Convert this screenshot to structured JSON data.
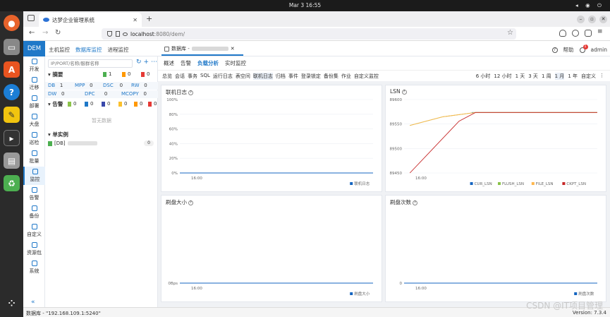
{
  "os": {
    "clock": "Mar 3  16:55"
  },
  "browser": {
    "tab_title": "达梦企业管理系统",
    "url_host": "localhost",
    "url_path": ":8080/dem/"
  },
  "app": {
    "brand": "DEM",
    "top_nav": [
      "主机监控",
      "数据库监控",
      "进程监控"
    ],
    "page_tab": "数据库 - ",
    "help": "帮助",
    "user": "admin",
    "badge": "1"
  },
  "side_nav": [
    "开发",
    "迁移",
    "部署",
    "大盘",
    "巡检",
    "批量",
    "监控",
    "告警",
    "备份",
    "自定义",
    "资源包",
    "系统"
  ],
  "instance_panel": {
    "search_placeholder": "IP/PORT/名称/服群名称",
    "summary_title": "摘要",
    "summary_counts": [
      "1",
      "0",
      "0"
    ],
    "db_types": [
      {
        "k": "DB",
        "v": "1"
      },
      {
        "k": "MPP",
        "v": "0"
      },
      {
        "k": "DSC",
        "v": "0"
      },
      {
        "k": "RW",
        "v": "0"
      },
      {
        "k": "DW",
        "v": "0"
      },
      {
        "k": "DPC",
        "v": "0"
      },
      {
        "k": "MCOPY",
        "v": "0"
      }
    ],
    "alarm_title": "告警",
    "alarm_counts": [
      "0",
      "0",
      "0",
      "0",
      "0",
      "0"
    ],
    "empty": "暂无数据",
    "single_title": "单实例",
    "instance_label": "[DB]",
    "instance_count": "0"
  },
  "content": {
    "sub_tabs": [
      "概述",
      "告警",
      "负载分析",
      "实时监控"
    ],
    "active_sub_tab": "负载分析",
    "categories": [
      "总览",
      "会话",
      "事务",
      "SQL",
      "运行日志",
      "表空间",
      "联机日志",
      "归档",
      "事件",
      "登录锁定",
      "备份集",
      "作业",
      "自定义监控"
    ],
    "active_category": "联机日志",
    "time_ranges": [
      "6 小时",
      "12 小时",
      "1 天",
      "3 天",
      "1 周",
      "1 月",
      "1 年",
      "自定义"
    ],
    "active_time": "1 月"
  },
  "charts": [
    {
      "title": "联机日志",
      "chart_data": {
        "type": "line",
        "x_ticks": [
          "16:00"
        ],
        "y_ticks": [
          "0%",
          "20%",
          "40%",
          "60%",
          "80%",
          "100%"
        ],
        "ylim": [
          0,
          100
        ],
        "series": [
          {
            "name": "联机日志",
            "color": "#1565c0",
            "values": [
              0,
              0,
              0,
              0,
              0,
              0,
              0,
              0,
              0,
              0,
              0,
              0,
              0,
              0,
              0,
              0,
              0,
              0,
              0,
              0
            ]
          }
        ]
      }
    },
    {
      "title": "LSN",
      "chart_data": {
        "type": "line",
        "x_ticks": [
          "16:00"
        ],
        "y_ticks": [
          "89450",
          "89500",
          "89550",
          "89600"
        ],
        "ylim": [
          89440,
          89610
        ],
        "series": [
          {
            "name": "CUR_LSN",
            "color": "#1565c0",
            "values": [
              89580,
              89580,
              89580
            ]
          },
          {
            "name": "FLUSH_LSN",
            "color": "#8bc34a",
            "values": [
              89550,
              89570,
              89580
            ]
          },
          {
            "name": "FILE_LSN",
            "color": "#ffb74d",
            "values": [
              89550,
              89570,
              89580
            ]
          },
          {
            "name": "CKPT_LSN",
            "color": "#c62828",
            "values": [
              89440,
              89480,
              89520,
              89560,
              89580
            ]
          }
        ]
      }
    },
    {
      "title": "刷盘大小",
      "chart_data": {
        "type": "line",
        "x_ticks": [
          "16:00"
        ],
        "y_ticks": [
          "0Bps"
        ],
        "series": [
          {
            "name": "刷盘大小",
            "color": "#1565c0",
            "values": [
              0,
              0,
              0,
              0,
              0,
              0,
              0,
              0,
              0,
              0,
              0,
              0,
              0,
              0,
              0,
              0,
              0,
              0,
              0,
              0
            ]
          }
        ]
      }
    },
    {
      "title": "刷盘次数",
      "chart_data": {
        "type": "line",
        "x_ticks": [
          "16:00"
        ],
        "y_ticks": [
          "0"
        ],
        "series": [
          {
            "name": "刷盘次数",
            "color": "#1565c0",
            "values": [
              0,
              0,
              0,
              0,
              0,
              0,
              0,
              0,
              0,
              0,
              0,
              0,
              0,
              0,
              0,
              0,
              0,
              0,
              0,
              0
            ]
          }
        ]
      }
    }
  ],
  "statusbar": {
    "left": "数据库 - \"192.168.109.1:5240\"",
    "right": "Version: 7.3.4"
  },
  "watermark": "CSDN @IT项目管理"
}
